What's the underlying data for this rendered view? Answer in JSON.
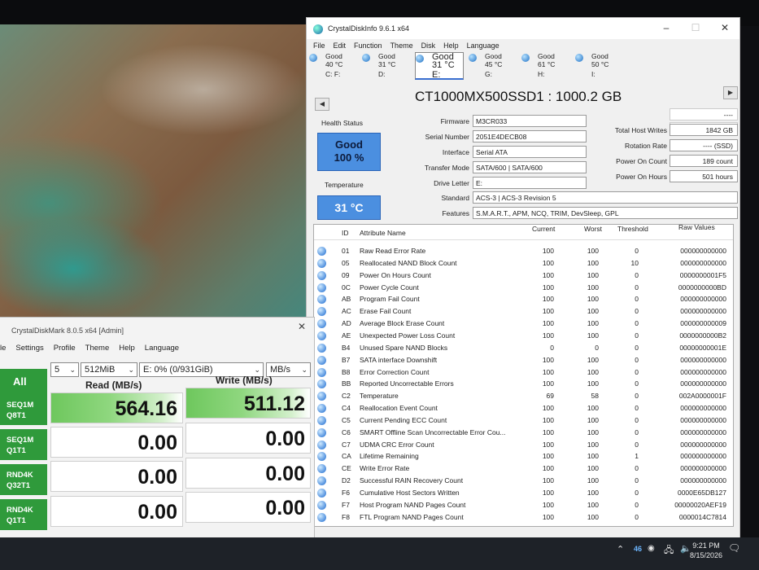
{
  "cdi": {
    "title": "CrystalDiskInfo 9.6.1 x64",
    "menu": [
      "File",
      "Edit",
      "Function",
      "Theme",
      "Disk",
      "Help",
      "Language"
    ],
    "drives": [
      {
        "status": "Good",
        "temp": "40 °C",
        "letter": "C: F:"
      },
      {
        "status": "Good",
        "temp": "31 °C",
        "letter": "D:"
      },
      {
        "status": "Good",
        "temp": "31 °C",
        "letter": "E:"
      },
      {
        "status": "Good",
        "temp": "45 °C",
        "letter": "G:"
      },
      {
        "status": "Good",
        "temp": "61 °C",
        "letter": "H:"
      },
      {
        "status": "Good",
        "temp": "50 °C",
        "letter": "I:"
      }
    ],
    "model": "CT1000MX500SSD1 : 1000.2 GB",
    "health_label": "Health Status",
    "health_status": "Good",
    "health_percent": "100 %",
    "temp_label": "Temperature",
    "temperature": "31 °C",
    "labels": {
      "firmware": "Firmware",
      "serial": "Serial Number",
      "interface": "Interface",
      "transfer": "Transfer Mode",
      "drive_letter": "Drive Letter",
      "standard": "Standard",
      "features": "Features",
      "host_writes": "Total Host Writes",
      "rotation": "Rotation Rate",
      "power_count": "Power On Count",
      "power_hours": "Power On Hours"
    },
    "values": {
      "firmware": "M3CR033",
      "serial": "2051E4DECB08",
      "interface": "Serial ATA",
      "transfer": "SATA/600 | SATA/600",
      "drive_letter": "E:",
      "standard": "ACS-3 | ACS-3 Revision 5",
      "features": "S.M.A.R.T., APM, NCQ, TRIM, DevSleep, GPL",
      "blank1": "----",
      "blank2": "----",
      "host_writes": "1842 GB",
      "rotation": "---- (SSD)",
      "power_count": "189 count",
      "power_hours": "501 hours"
    },
    "smart_headers": [
      "ID",
      "Attribute Name",
      "Current",
      "Worst",
      "Threshold",
      "Raw Values"
    ],
    "smart_rows": [
      [
        "01",
        "Raw Read Error Rate",
        "100",
        "100",
        "0",
        "000000000000"
      ],
      [
        "05",
        "Reallocated NAND Block Count",
        "100",
        "100",
        "10",
        "000000000000"
      ],
      [
        "09",
        "Power On Hours Count",
        "100",
        "100",
        "0",
        "0000000001F5"
      ],
      [
        "0C",
        "Power Cycle Count",
        "100",
        "100",
        "0",
        "0000000000BD"
      ],
      [
        "AB",
        "Program Fail Count",
        "100",
        "100",
        "0",
        "000000000000"
      ],
      [
        "AC",
        "Erase Fail Count",
        "100",
        "100",
        "0",
        "000000000000"
      ],
      [
        "AD",
        "Average Block Erase Count",
        "100",
        "100",
        "0",
        "000000000009"
      ],
      [
        "AE",
        "Unexpected Power Loss Count",
        "100",
        "100",
        "0",
        "0000000000B2"
      ],
      [
        "B4",
        "Unused Spare NAND Blocks",
        "0",
        "0",
        "0",
        "00000000001E"
      ],
      [
        "B7",
        "SATA interface Downshift",
        "100",
        "100",
        "0",
        "000000000000"
      ],
      [
        "B8",
        "Error Correction Count",
        "100",
        "100",
        "0",
        "000000000000"
      ],
      [
        "BB",
        "Reported Uncorrectable Errors",
        "100",
        "100",
        "0",
        "000000000000"
      ],
      [
        "C2",
        "Temperature",
        "69",
        "58",
        "0",
        "002A0000001F"
      ],
      [
        "C4",
        "Reallocation Event Count",
        "100",
        "100",
        "0",
        "000000000000"
      ],
      [
        "C5",
        "Current Pending ECC Count",
        "100",
        "100",
        "0",
        "000000000000"
      ],
      [
        "C6",
        "SMART Offline Scan Uncorrectable Error Cou...",
        "100",
        "100",
        "0",
        "000000000000"
      ],
      [
        "C7",
        "UDMA CRC Error Count",
        "100",
        "100",
        "0",
        "000000000000"
      ],
      [
        "CA",
        "Lifetime Remaining",
        "100",
        "100",
        "1",
        "000000000000"
      ],
      [
        "CE",
        "Write Error Rate",
        "100",
        "100",
        "0",
        "000000000000"
      ],
      [
        "D2",
        "Successful RAIN Recovery Count",
        "100",
        "100",
        "0",
        "000000000000"
      ],
      [
        "F6",
        "Cumulative Host Sectors Written",
        "100",
        "100",
        "0",
        "0000E65DB127"
      ],
      [
        "F7",
        "Host Program NAND Pages Count",
        "100",
        "100",
        "0",
        "00000020AEF19"
      ],
      [
        "F8",
        "FTL Program NAND Pages Count",
        "100",
        "100",
        "0",
        "0000014C7814"
      ]
    ]
  },
  "cdm": {
    "title": "CrystalDiskMark 8.0.5 x64 [Admin]",
    "menu": [
      "le",
      "Settings",
      "Profile",
      "Theme",
      "Help",
      "Language"
    ],
    "all_label": "All",
    "count": "5",
    "size": "512MiB",
    "drive": "E: 0% (0/931GiB)",
    "unit": "MB/s",
    "read_header": "Read (MB/s)",
    "write_header": "Write (MB/s)",
    "tests": [
      {
        "l1": "SEQ1M",
        "l2": "Q8T1",
        "read": "564.16",
        "write": "511.12"
      },
      {
        "l1": "SEQ1M",
        "l2": "Q1T1",
        "read": "0.00",
        "write": "0.00"
      },
      {
        "l1": "RND4K",
        "l2": "Q32T1",
        "read": "0.00",
        "write": "0.00"
      },
      {
        "l1": "RND4K",
        "l2": "Q1T1",
        "read": "0.00",
        "write": "0.00"
      }
    ]
  },
  "taskbar": {
    "badge": "46",
    "time": "9:21 PM",
    "date": "8/15/2026"
  }
}
